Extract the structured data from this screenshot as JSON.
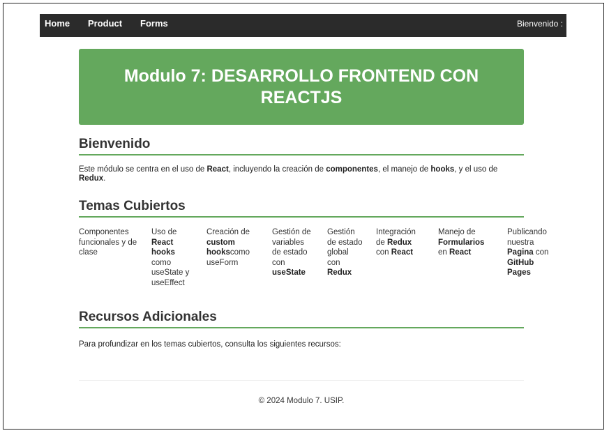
{
  "nav": {
    "home": "Home",
    "product": "Product",
    "forms": "Forms",
    "welcome": "Bienvenido :"
  },
  "hero": {
    "title": "Modulo 7: DESARROLLO FRONTEND CON REACTJS"
  },
  "welcome_section": {
    "title": "Bienvenido",
    "t1": "Este módulo se centra en el uso de ",
    "b1": "React",
    "t2": ", incluyendo la creación de ",
    "b2": "componentes",
    "t3": ", el manejo de ",
    "b3": "hooks",
    "t4": ", y el uso de ",
    "b4": "Redux",
    "t5": "."
  },
  "topics_section": {
    "title": "Temas Cubiertos",
    "items": [
      {
        "p1": "Componentes funcionales y de clase"
      },
      {
        "p1": "Uso de ",
        "b1": "React hooks",
        "p2": " como useState y useEffect"
      },
      {
        "p1": "Creación de ",
        "b1": "custom hooks",
        "p2": "como useForm"
      },
      {
        "p1": "Gestión de variables de estado con ",
        "b1": "useState"
      },
      {
        "p1": "Gestión de estado global con ",
        "b1": "Redux"
      },
      {
        "p1": "Integración de ",
        "b1": "Redux",
        "p2": " con ",
        "b2": "React"
      },
      {
        "p1": "Manejo de ",
        "b1": "Formularios",
        "p2": " en ",
        "b2": "React"
      },
      {
        "p1": "Publicando nuestra ",
        "b1": "Pagina",
        "p2": " con ",
        "b2": "GitHub Pages"
      }
    ]
  },
  "resources_section": {
    "title": "Recursos Adicionales",
    "text": "Para profundizar en los temas cubiertos, consulta los siguientes recursos:"
  },
  "footer": {
    "text": "© 2024 Modulo 7. USIP."
  }
}
